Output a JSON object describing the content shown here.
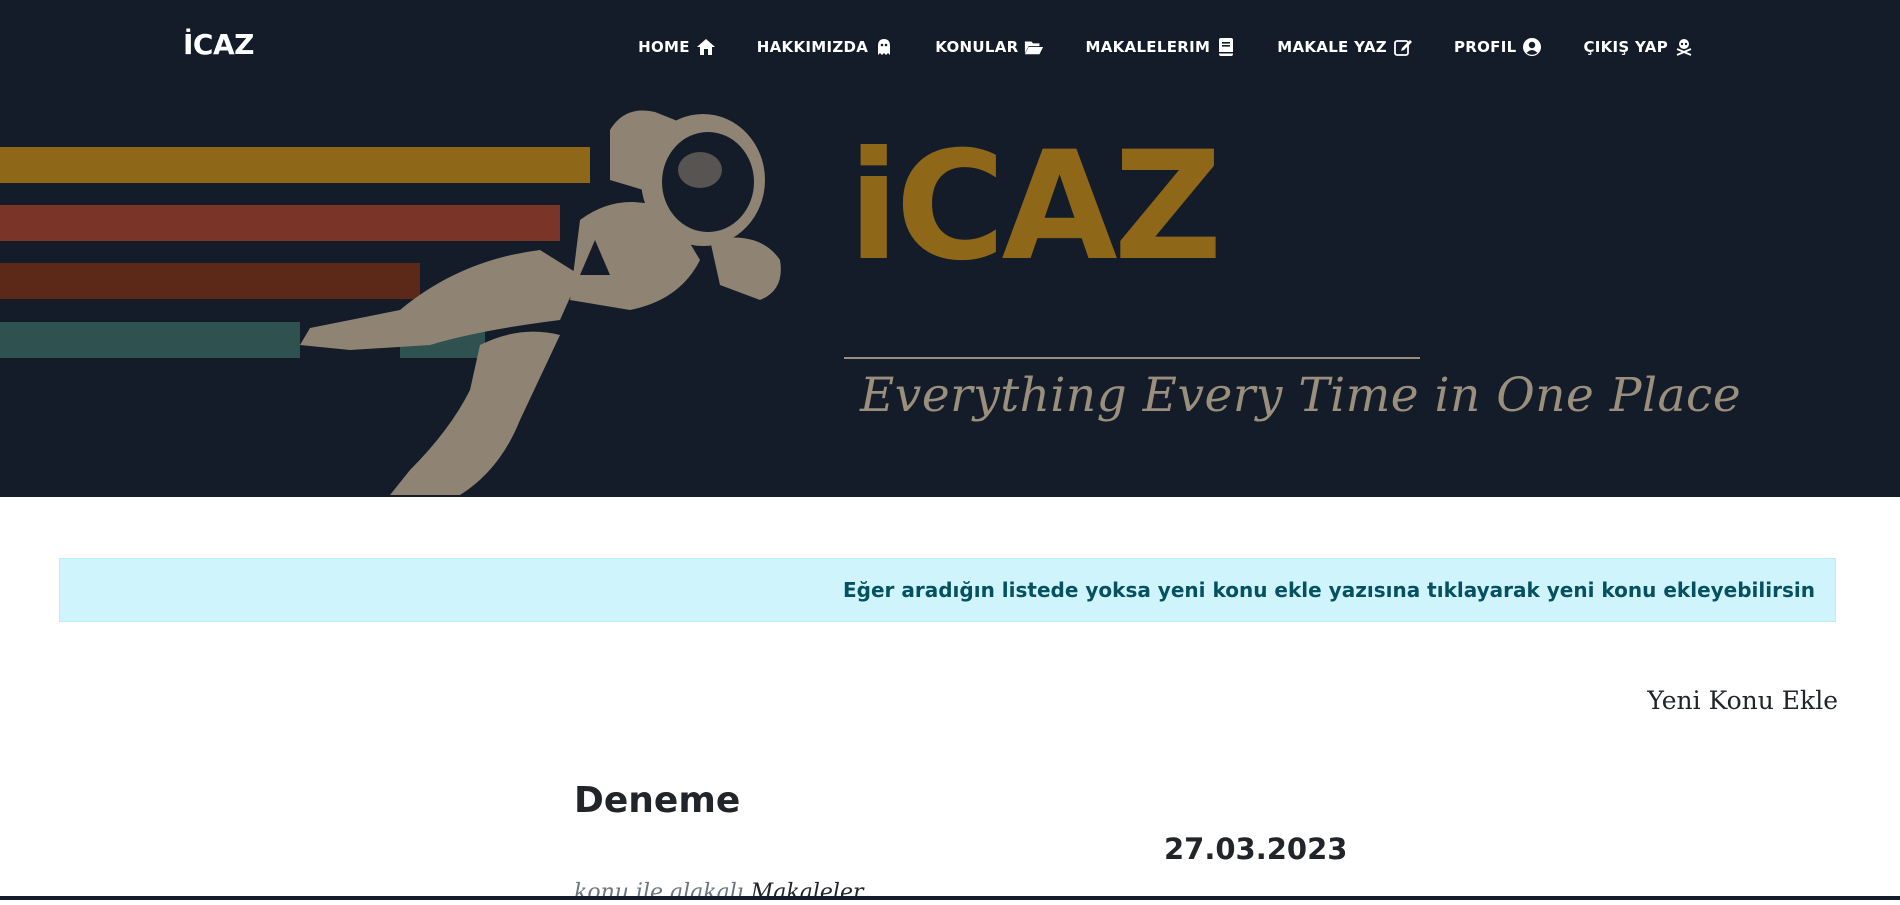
{
  "brand": "İCAZ",
  "nav": {
    "items": [
      {
        "label": "HOME",
        "icon": "home-icon"
      },
      {
        "label": "HAKKIMIZDA",
        "icon": "ghost-icon"
      },
      {
        "label": "KONULAR",
        "icon": "folder-open-icon"
      },
      {
        "label": "MAKALELERIM",
        "icon": "book-icon"
      },
      {
        "label": "MAKALE YAZ",
        "icon": "edit-icon"
      },
      {
        "label": "PROFIL",
        "icon": "user-circle-icon"
      },
      {
        "label": "ÇIKIŞ YAP",
        "icon": "skull-crossbones-icon"
      }
    ]
  },
  "hero": {
    "logo_text": "iCAZ",
    "tagline": "Everything Every Time in One Place",
    "colors": {
      "background": "#131c28",
      "logo": "#8e6718",
      "stripe1": "#8e6718",
      "stripe2": "#7a3428",
      "stripe3": "#5c2818",
      "stripe4": "#2f5250",
      "astronaut": "#8f8374"
    }
  },
  "alert": {
    "text": "Eğer aradığın listede yoksa yeni konu ekle yazısına tıklayarak yeni konu ekleyebilirsin"
  },
  "new_topic_link": "Yeni Konu Ekle",
  "topic": {
    "title": "Deneme",
    "date": "27.03.2023",
    "related_prefix": "konu ile alakalı",
    "related_link": "Makaleler"
  }
}
